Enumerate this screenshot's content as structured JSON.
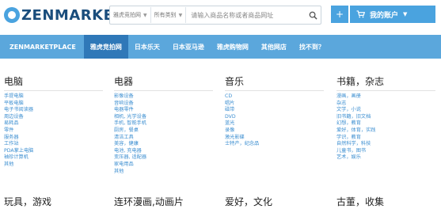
{
  "header": {
    "logo_text": "ZENMARKET",
    "search": {
      "select_site": "雅虎竞拍网",
      "select_category": "所有类别",
      "placeholder": "请输入商品名称或者商品网址"
    },
    "plus_label": "+",
    "account_label": "我的账户"
  },
  "nav": {
    "items": [
      {
        "label": "ZENMARKETPLACE"
      },
      {
        "label": "雅虎竞拍网",
        "active": true
      },
      {
        "label": "日本乐天"
      },
      {
        "label": "日本亚马逊"
      },
      {
        "label": "雅虎购物网"
      },
      {
        "label": "其他网店"
      },
      {
        "label": "找不到？"
      }
    ]
  },
  "categories": [
    {
      "title": "电脑",
      "links": [
        "手提电脑",
        "平板电脑",
        "电子书阅读器",
        "周边设备",
        "易耗品",
        "零件",
        "服务器",
        "工作站",
        "PDA掌上电脑",
        "袖珍计算机",
        "其他"
      ]
    },
    {
      "title": "电器",
      "links": [
        "影像设备",
        "音响设备",
        "电器零件",
        "相机, 光学设备",
        "手机, 智能手机",
        "厨房，餐桌",
        "清洁工具",
        "美容，健康",
        "电池, 充电器",
        "变压器, 适配器",
        "家电用品",
        "其他"
      ]
    },
    {
      "title": "音乐",
      "links": [
        "CD",
        "唱片",
        "磁带",
        "DVD",
        "蓝光",
        "录像",
        "激光影碟",
        "士特产，纪念品"
      ]
    },
    {
      "title": "书籍，杂志",
      "links": [
        "漫画，画册",
        "杂志",
        "文学，小说",
        "旧书籍，旧文档",
        "幻想，教育",
        "爱好，体育，实践",
        "学识，教育",
        "自然科学，科技",
        "儿童书，图书",
        "艺术，娱乐"
      ]
    }
  ],
  "row2": [
    {
      "title": "玩具，游戏"
    },
    {
      "title": "连环漫画,动画片"
    },
    {
      "title": "爱好，文化"
    },
    {
      "title": "古董，收集"
    }
  ]
}
